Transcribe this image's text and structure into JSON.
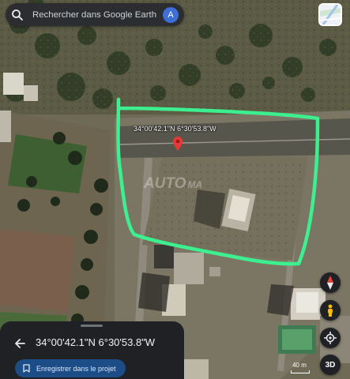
{
  "search": {
    "placeholder": "Rechercher dans Google Earth",
    "avatar_letter": "A"
  },
  "map": {
    "pin_coordinates": "34°00'42.1\"N 6°30'53.8\"W",
    "watermark": "AUTO",
    "watermark_suffix": "MA",
    "outline_color": "#3df08f",
    "pin_color": "#e53935"
  },
  "controls": {
    "three_d_label": "3D",
    "scale_label": "40 m"
  },
  "place_sheet": {
    "title": "34°00'42.1\"N 6°30'53.8\"W",
    "save_label": "Enregistrer dans le projet"
  },
  "colors": {
    "sheet_bg": "#202124",
    "save_button_bg": "#1d4d86",
    "avatar_bg": "#3d6fd6"
  }
}
